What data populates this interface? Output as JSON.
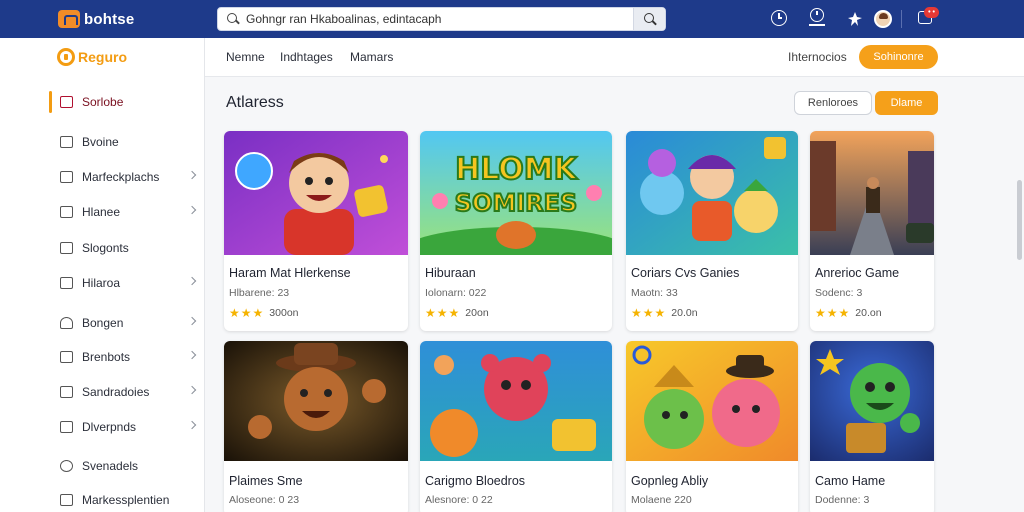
{
  "brand": {
    "name": "bohtse"
  },
  "search": {
    "value": "Gohngr ran Hkaboalinas, edintacaph"
  },
  "sidebar": {
    "brand_name": "Reguro",
    "items": [
      {
        "label": "Sorlobe",
        "chevron": false,
        "active": true
      },
      {
        "label": "Bvoine",
        "chevron": false,
        "active": false
      },
      {
        "label": "Marfeckplachs",
        "chevron": true,
        "active": false
      },
      {
        "label": "Hlanee",
        "chevron": true,
        "active": false
      },
      {
        "label": "Slogonts",
        "chevron": false,
        "active": false
      },
      {
        "label": "Hilaroa",
        "chevron": true,
        "active": false
      },
      {
        "label": "Bongen",
        "chevron": true,
        "active": false
      },
      {
        "label": "Brenbots",
        "chevron": true,
        "active": false
      },
      {
        "label": "Sandradoies",
        "chevron": true,
        "active": false
      },
      {
        "label": "Dlverpnds",
        "chevron": true,
        "active": false
      },
      {
        "label": "Svenadels",
        "chevron": false,
        "active": false
      },
      {
        "label": "Markessplentien",
        "chevron": false,
        "active": false
      }
    ]
  },
  "subnav": {
    "tabs": [
      "Nemne",
      "Indhtages",
      "Mamars"
    ],
    "right_link": "Ihternocios",
    "cta": "Sohinonre"
  },
  "section": {
    "title": "Atlaress",
    "btn_outline": "Renloroes",
    "btn_fill": "Dlame"
  },
  "cards": [
    {
      "title": "Haram Mat Hlerkense",
      "sub": "Hlbarene: 23",
      "rating_text": "300on",
      "stars": 3
    },
    {
      "title": "Hiburaan",
      "sub": "Iolonarn: 022",
      "rating_text": "20on",
      "stars": 3
    },
    {
      "title": "Coriars Cvs Ganies",
      "sub": "Maotn: 33",
      "rating_text": "20.0n",
      "stars": 3
    },
    {
      "title": "Anrerioc Game",
      "sub": "Sodenc: 3",
      "rating_text": "20.on",
      "stars": 3
    },
    {
      "title": "Plaimes Sme",
      "sub": "Aloseone: 0 23",
      "rating_text": "",
      "stars": 0
    },
    {
      "title": "Carigmo Bloedros",
      "sub": "Alesnore: 0 22",
      "rating_text": "",
      "stars": 0
    },
    {
      "title": "Gopnleg Abliy",
      "sub": "Molaene 220",
      "rating_text": "",
      "stars": 0
    },
    {
      "title": "Camo Hame",
      "sub": "Dodenne: 3",
      "rating_text": "",
      "stars": 0
    }
  ],
  "thumb_text": {
    "card2_line1": "HLOMK",
    "card2_line2": "SOMIRES"
  },
  "colors": {
    "topbar": "#1e3a8a",
    "accent": "#f5a01a",
    "active": "#7a1020"
  }
}
